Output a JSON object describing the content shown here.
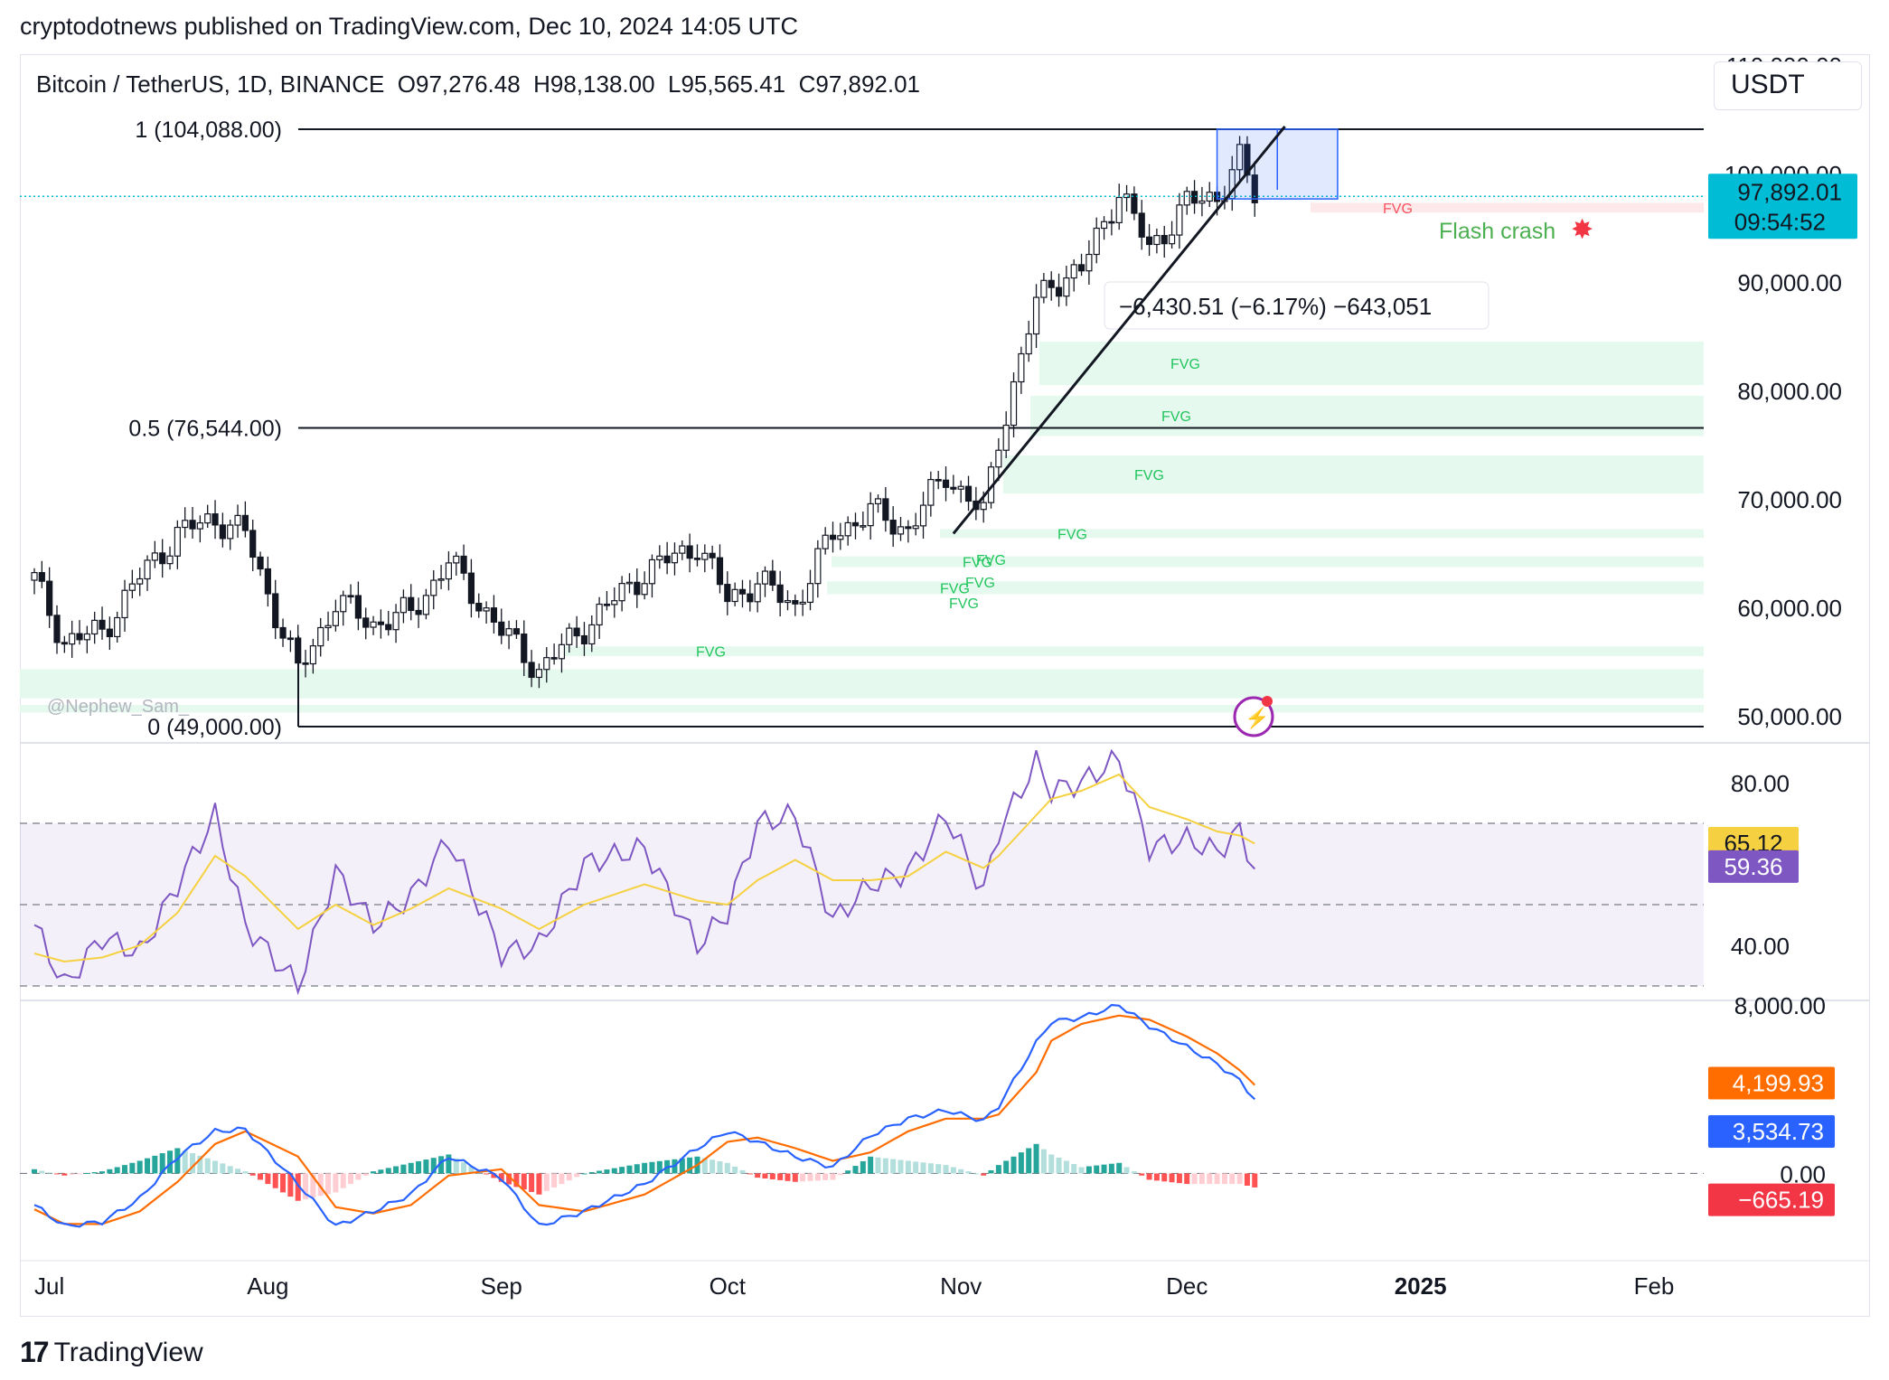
{
  "header": {
    "text": "cryptodotnews published on TradingView.com, Dec 10, 2024 14:05 UTC"
  },
  "legend": {
    "text": "Bitcoin / TetherUS, 1D, BINANCE  O97,276.48  H98,138.00  L95,565.41  C97,892.01"
  },
  "currency_button": "USDT",
  "watermark": "@Nephew_Sam_",
  "footer": {
    "logo": "17",
    "brand": "TradingView"
  },
  "colors": {
    "up": "#089981",
    "down": "#f23645",
    "candle": "#131722",
    "fvg": "#e6f9ee",
    "fvg_text": "#22c55e",
    "rsi": "#7e57c2",
    "rsi_ma": "#f5d142",
    "macd": "#2962ff",
    "signal": "#ff6d00",
    "price_tag": "#00bcd4"
  },
  "chart_data": [
    {
      "type": "candlestick",
      "title": "Bitcoin / TetherUS, 1D, BINANCE",
      "ohlc_last": {
        "open": 97276.48,
        "high": 98138.0,
        "low": 95565.41,
        "close": 97892.01
      },
      "last_price": "97,892.01",
      "countdown": "09:54:52",
      "y_ticks": [
        "110,000.00",
        "100,000.00",
        "90,000.00",
        "80,000.00",
        "70,000.00",
        "60,000.00",
        "50,000.00"
      ],
      "ylim": [
        47500,
        111000
      ],
      "x_ticks": [
        "Jul",
        "Aug",
        "Sep",
        "Oct",
        "Nov",
        "Dec",
        "2025",
        "Feb"
      ],
      "fib_levels": [
        {
          "label": "1 (104,088.00)",
          "value": 104088
        },
        {
          "label": "0.5 (76,544.00)",
          "value": 76544
        },
        {
          "label": "0 (49,000.00)",
          "value": 49000
        }
      ],
      "measure_label": "−6,430.51 (−6.17%) −643,051",
      "annotation": "Flash crash",
      "fvg_label": "FVG",
      "fvg_zones": [
        {
          "low": 80500,
          "high": 84500
        },
        {
          "low": 75800,
          "high": 79500
        },
        {
          "low": 70500,
          "high": 74000
        },
        {
          "low": 66400,
          "high": 67200
        },
        {
          "low": 63700,
          "high": 64700
        },
        {
          "low": 61200,
          "high": 62400
        },
        {
          "low": 55500,
          "high": 56400
        },
        {
          "low": 51600,
          "high": 54300
        },
        {
          "low": 50300,
          "high": 51000
        },
        {
          "low": 96400,
          "high": 97300
        }
      ],
      "close_path_dates": [
        "Jul 1",
        "Jul 5",
        "Jul 10",
        "Jul 15",
        "Jul 20",
        "Jul 25",
        "Jul 29",
        "Aug 5",
        "Aug 10",
        "Aug 15",
        "Aug 20",
        "Aug 25",
        "Sep 1",
        "Sep 6",
        "Sep 12",
        "Sep 20",
        "Sep 27",
        "Oct 1",
        "Oct 5",
        "Oct 10",
        "Oct 15",
        "Oct 20",
        "Oct 25",
        "Oct 30",
        "Nov 4",
        "Nov 6",
        "Nov 11",
        "Nov 13",
        "Nov 17",
        "Nov 22",
        "Nov 26",
        "Dec 1",
        "Dec 5",
        "Dec 8",
        "Dec 10"
      ],
      "close_path_values": [
        62500,
        56800,
        57800,
        62800,
        66800,
        68200,
        66800,
        54000,
        60500,
        58500,
        59500,
        64200,
        57800,
        54200,
        58200,
        63200,
        65800,
        60800,
        62300,
        60200,
        66800,
        68800,
        67200,
        72300,
        68500,
        75500,
        88000,
        90000,
        91000,
        98500,
        93000,
        97200,
        98000,
        101200,
        97892
      ]
    },
    {
      "type": "line",
      "title": "RSI",
      "y_ticks": [
        "80.00",
        "40.00"
      ],
      "ylim": [
        28,
        88
      ],
      "bands": [
        70,
        50,
        30
      ],
      "last_rsi_ma": "65.12",
      "last_rsi": "59.36",
      "series": [
        {
          "name": "RSI",
          "values": [
            45,
            30,
            42,
            38,
            55,
            72,
            45,
            30,
            58,
            45,
            52,
            66,
            38,
            40,
            60,
            64,
            40,
            48,
            70,
            72,
            46,
            55,
            58,
            72,
            53,
            68,
            85,
            78,
            80,
            86,
            64,
            66,
            63,
            68,
            59
          ]
        },
        {
          "name": "RSI MA",
          "values": [
            38,
            36,
            37,
            40,
            48,
            62,
            57,
            44,
            50,
            45,
            49,
            54,
            49,
            44,
            50,
            55,
            51,
            50,
            56,
            61,
            56,
            56,
            57,
            63,
            59,
            62,
            72,
            76,
            78,
            82,
            74,
            71,
            68,
            67,
            65
          ]
        }
      ]
    },
    {
      "type": "line",
      "title": "MACD",
      "y_ticks": [
        "8,000.00",
        "0.00"
      ],
      "ylim": [
        -3500,
        8000
      ],
      "last_signal": "4,199.93",
      "last_macd": "3,534.73",
      "last_hist": "−665.19",
      "series": [
        {
          "name": "MACD",
          "values": [
            -1500,
            -2500,
            -2300,
            -1200,
            800,
            2000,
            2100,
            -500,
            -2500,
            -1800,
            -1000,
            800,
            -200,
            -2500,
            -1800,
            -500,
            1200,
            2000,
            1500,
            800,
            300,
            1800,
            2600,
            3000,
            2500,
            3200,
            6200,
            7200,
            7400,
            8000,
            7000,
            6000,
            5200,
            4400,
            3534.73
          ]
        },
        {
          "name": "Signal",
          "values": [
            -1700,
            -2400,
            -2400,
            -1800,
            -400,
            1400,
            2000,
            800,
            -1600,
            -1900,
            -1500,
            -100,
            200,
            -1500,
            -1800,
            -1000,
            400,
            1500,
            1700,
            1200,
            600,
            1000,
            2000,
            2600,
            2600,
            2800,
            4800,
            6300,
            7100,
            7500,
            7300,
            6500,
            5700,
            4900,
            4199.93
          ]
        },
        {
          "name": "Histogram",
          "values": [
            200,
            -100,
            100,
            600,
            1200,
            600,
            100,
            -1300,
            -900,
            100,
            500,
            900,
            -400,
            -1000,
            0,
            500,
            800,
            500,
            -200,
            -400,
            -300,
            800,
            600,
            400,
            -100,
            400,
            1400,
            900,
            300,
            500,
            -300,
            -500,
            -500,
            -500,
            -665.19
          ]
        }
      ]
    }
  ]
}
